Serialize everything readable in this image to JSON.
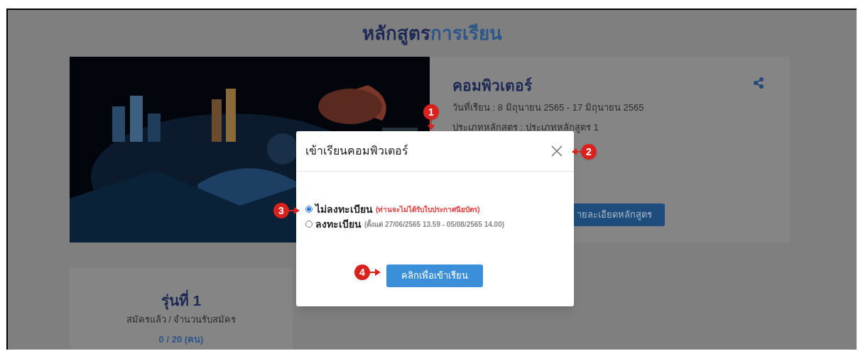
{
  "page_title": {
    "part_1": "หลักสูตร",
    "part_2": "การเรียน"
  },
  "course": {
    "kind": "picture",
    "name": "คอมพิวเตอร์",
    "study_dates": "วันที่เรียน : 8 มิถุนายน 2565 - 17 มิถุนายน 2565",
    "course_type": "ประเภทหลักสตร : ประเภทหลักสูตร 1",
    "details_button": "ายละเอียดหลักสูตร"
  },
  "batch": {
    "title": "รุ่นที่ 1",
    "caption": "สมัครแล้ว / จำนวนรับสมัคร",
    "count": "0 / 20 (คน)"
  },
  "dialog": {
    "title": "เข้าเรียนคอมพิวเตอร์",
    "options": [
      {
        "label": "ไม่ลงทะเบียน",
        "note": "(ท่านจะไม่ได้รับใบประกาศนียบัตร)",
        "color": "#e23b3b",
        "selected": true
      },
      {
        "label": "ลงทะเบียน",
        "note": "(ตั้งแต่ 27/06/2565 13.59 - 05/08/2565 14.00)",
        "color": "#888888",
        "selected": false
      }
    ],
    "submit_button": "คลิกเพื่อเข้าเรียน"
  },
  "callouts": [
    "1",
    "2",
    "3",
    "4"
  ]
}
